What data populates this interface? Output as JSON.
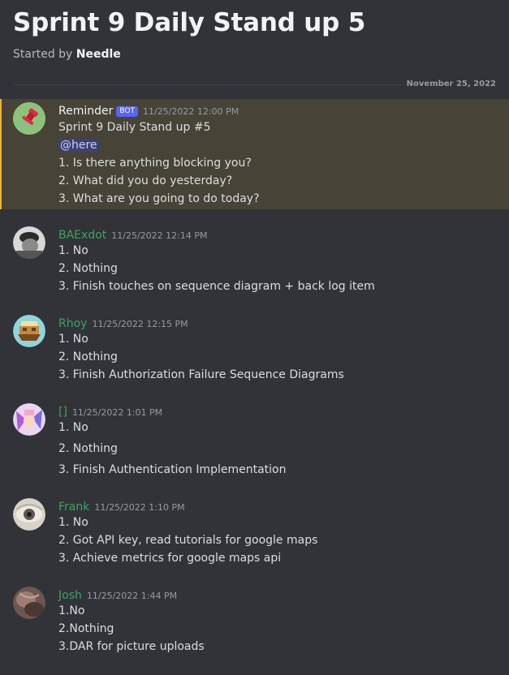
{
  "thread": {
    "title": "Sprint 9 Daily Stand up 5",
    "started_by_prefix": "Started by ",
    "started_by_user": "Needle",
    "date_divider": "November 25, 2022"
  },
  "colors": {
    "background": "#313338",
    "highlight_bg": "#474337",
    "highlight_border": "#f0b232",
    "reminder_name": "#dbdee1",
    "member_name": "#3ba55d",
    "bot_tag": "#5865f2"
  },
  "messages": [
    {
      "author": "Reminder",
      "bot_tag": "BOT",
      "time": "11/25/2022 12:00 PM",
      "avatar_icon": "pushpin-icon",
      "mention": "@here",
      "lines": [
        "Sprint 9 Daily Stand up #5",
        "1. Is there anything blocking you?",
        "2. What did you do yesterday?",
        "3. What are you going to do today?"
      ]
    },
    {
      "author": "BAExdot",
      "time": "11/25/2022 12:14 PM",
      "avatar_icon": "user-photo-avatar",
      "lines": [
        "1. No",
        "2. Nothing",
        "3. Finish touches on sequence diagram + back log item"
      ]
    },
    {
      "author": "Rhoy",
      "time": "11/25/2022 12:15 PM",
      "avatar_icon": "ship-avatar",
      "lines": [
        "1. No",
        "2. Nothing",
        "3. Finish Authorization Failure Sequence Diagrams"
      ]
    },
    {
      "author": "[]",
      "time": "11/25/2022 1:01 PM",
      "avatar_icon": "anime-avatar",
      "lines": [
        "1. No",
        "2. Nothing",
        "3. Finish Authentication Implementation"
      ]
    },
    {
      "author": "Frank",
      "time": "11/25/2022 1:10 PM",
      "avatar_icon": "eye-avatar",
      "lines": [
        "1. No",
        "2. Got API key, read tutorials for google maps",
        "3. Achieve metrics for google maps api"
      ]
    },
    {
      "author": "Josh",
      "time": "11/25/2022 1:44 PM",
      "avatar_icon": "photo-avatar",
      "lines": [
        "1.No",
        "2.Nothing",
        "3.DAR for picture uploads"
      ]
    }
  ]
}
